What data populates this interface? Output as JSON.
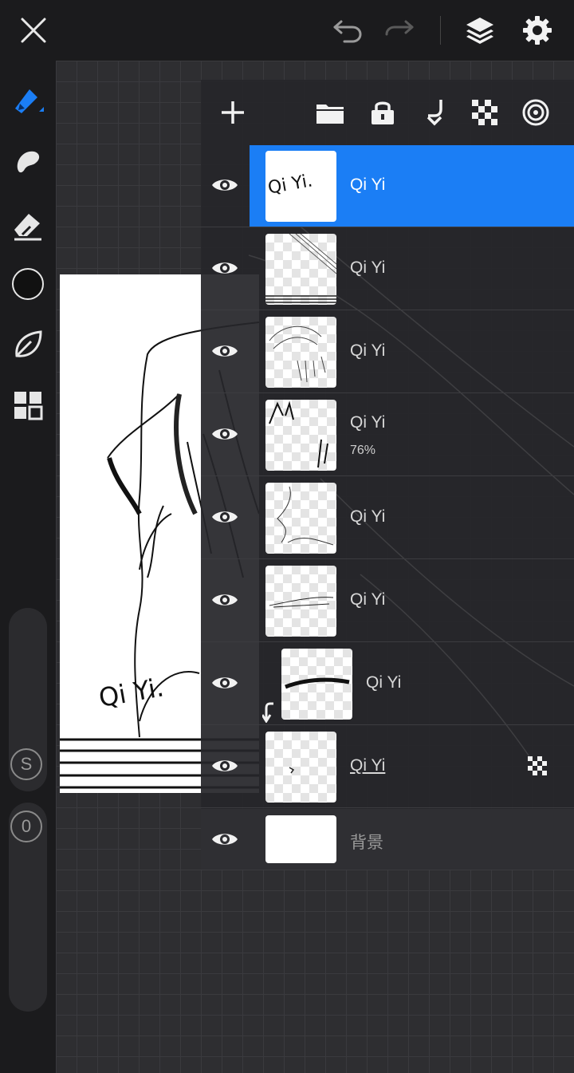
{
  "icons": {
    "close": "close-icon",
    "undo": "undo-icon",
    "redo": "redo-icon",
    "layers": "layers-icon",
    "settings": "gear-icon",
    "brush": "brush-icon",
    "smudge": "smudge-icon",
    "eraser": "eraser-icon",
    "color": "color-circle-icon",
    "leaf": "leaf-icon",
    "grid": "grid-icon"
  },
  "sidebar": {
    "size_knob_label": "S",
    "opacity_knob_label": "0"
  },
  "artwork": {
    "signature": "Qi Yi."
  },
  "layers_panel": {
    "toolbar": [
      "add-icon",
      "folder-icon",
      "lock-icon",
      "merge-down-icon",
      "checkerboard-icon",
      "target-icon"
    ],
    "layers": [
      {
        "name": "Qi Yi",
        "active": true,
        "thumb_text": "Qi Yi."
      },
      {
        "name": "Qi Yi"
      },
      {
        "name": "Qi Yi"
      },
      {
        "name": "Qi Yi",
        "opacity": "76%"
      },
      {
        "name": "Qi Yi"
      },
      {
        "name": "Qi Yi"
      },
      {
        "name": "Qi Yi",
        "clipped": true
      },
      {
        "name": "Qi Yi",
        "alpha_lock": true
      },
      {
        "name": "背景",
        "background": true
      }
    ]
  },
  "colors": {
    "accent": "#1b7ef5",
    "topbar": "#1b1b1d",
    "panel": "#26262a"
  }
}
